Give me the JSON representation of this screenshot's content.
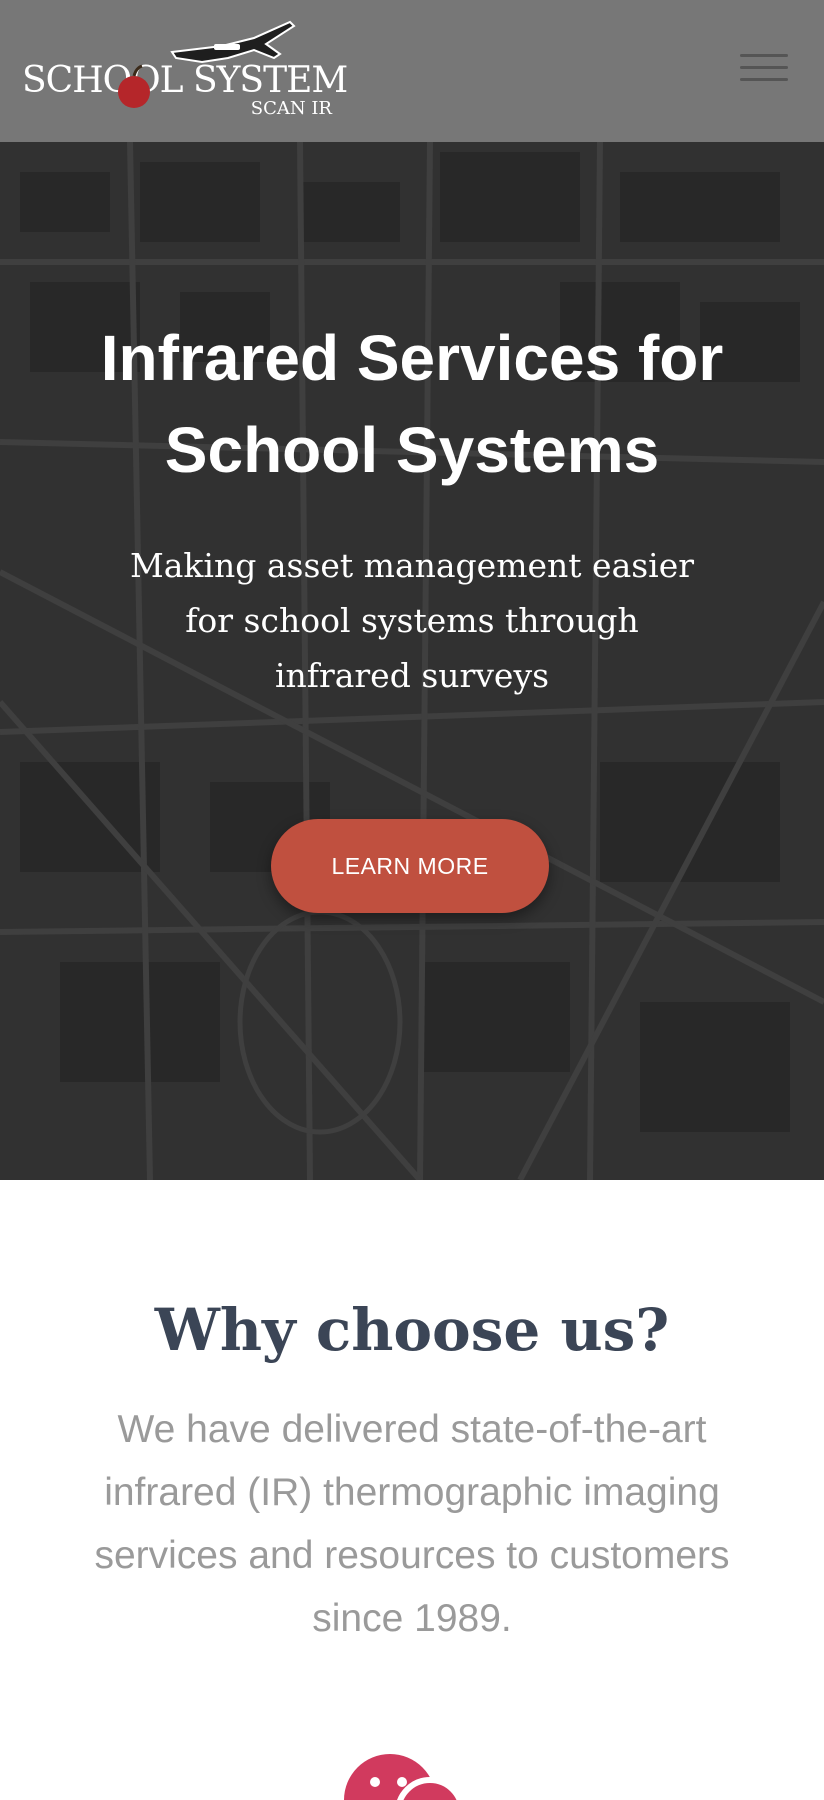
{
  "header": {
    "logo_text": "SCHOOL SYSTEM",
    "logo_subtext": "SCAN IR",
    "menu_label": "menu-icon"
  },
  "hero": {
    "title": "Infrared Services for School Systems",
    "subtitle": "Making asset management easier for school systems through infrared surveys",
    "cta_label": "LEARN MORE"
  },
  "why": {
    "title": "Why choose us?",
    "text": "We have delivered state-of-the-art infrared (IR) thermographic imaging services and resources to customers since 1989.",
    "icon": "chat-icon"
  },
  "colors": {
    "header_bg": "#777777",
    "hero_bg": "#3c3c3c",
    "cta_bg": "#c0503f",
    "heading_color": "#3b4556",
    "body_text": "#9a9a9a",
    "icon_accent": "#d13a5e"
  }
}
